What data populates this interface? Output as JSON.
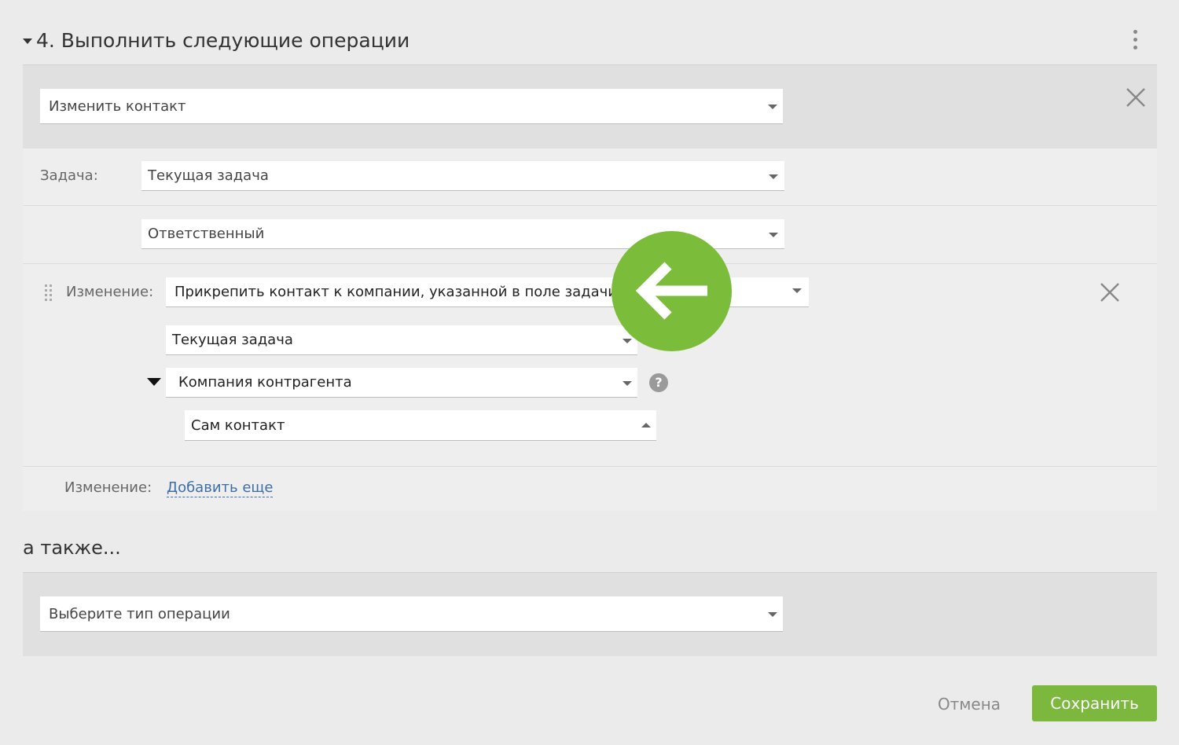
{
  "header": {
    "title": "4. Выполнить следующие операции"
  },
  "operation": {
    "type_value": "Изменить контакт"
  },
  "task": {
    "label": "Задача:",
    "value": "Текущая задача",
    "field_value": "Ответственный"
  },
  "change": {
    "label": "Изменение:",
    "action_value": "Прикрепить контакт к компании, указанной в поле задачи",
    "source_value": "Текущая задача",
    "field_value": "Компания контрагента",
    "fallback_value": "Сам контакт"
  },
  "add_change": {
    "label": "Изменение:",
    "link": "Добавить еще"
  },
  "also": {
    "heading": "а также...",
    "select_value": "Выберите тип операции"
  },
  "help_icon_glyph": "?",
  "footer": {
    "cancel": "Отмена",
    "save": "Сохранить"
  },
  "colors": {
    "accent": "#7cb83d",
    "link": "#3d6ea5"
  }
}
